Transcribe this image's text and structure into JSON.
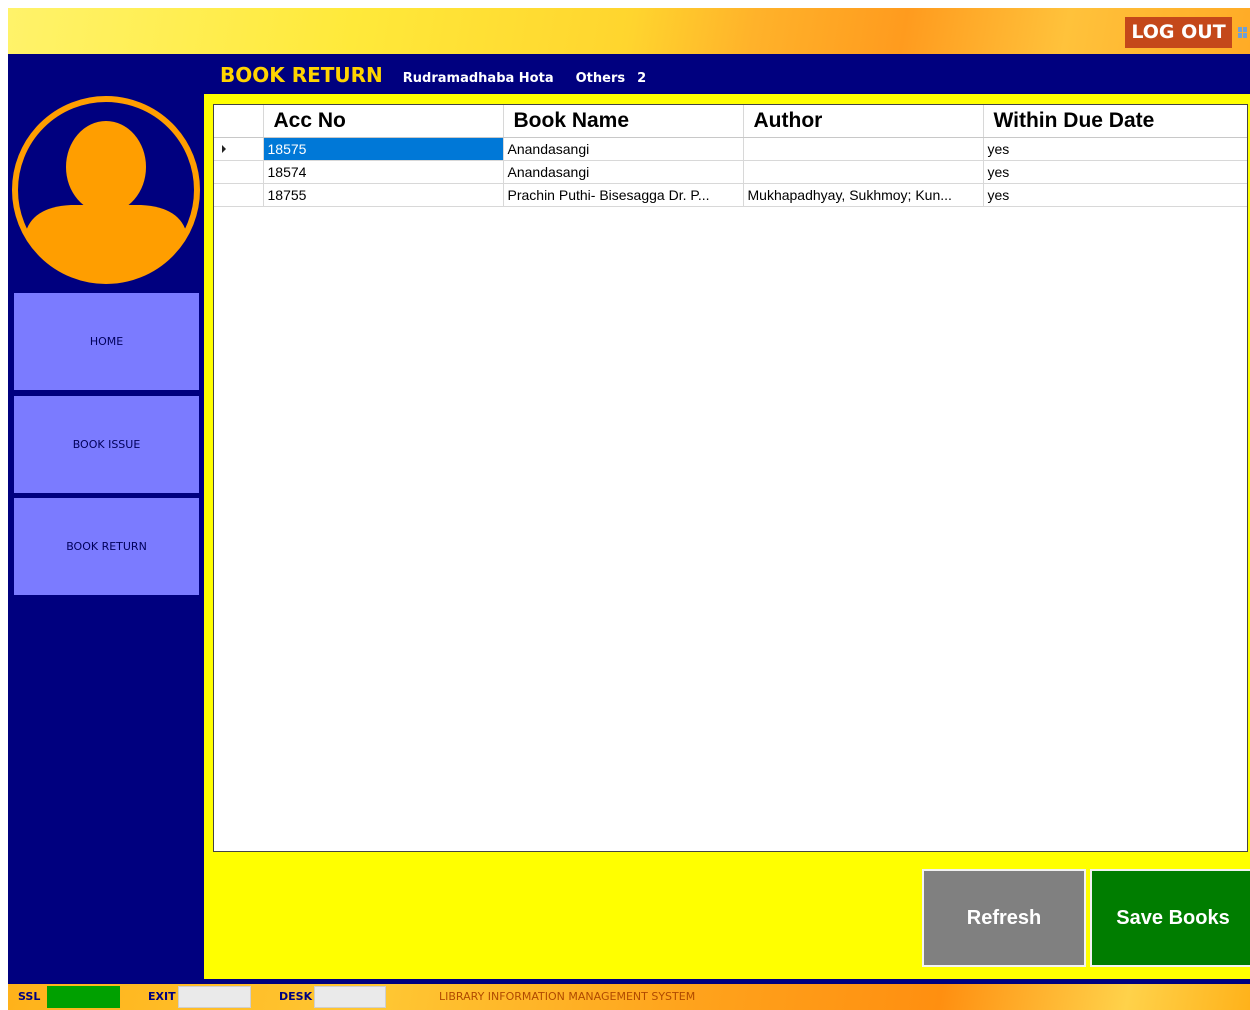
{
  "topbar": {
    "logout_label": "LOG OUT"
  },
  "header": {
    "title": "BOOK RETURN",
    "user_name": "Rudramadhaba Hota",
    "category": "Others",
    "count": "2"
  },
  "sidebar": {
    "items": [
      {
        "label": "HOME"
      },
      {
        "label": "BOOK ISSUE"
      },
      {
        "label": "BOOK RETURN"
      }
    ]
  },
  "grid": {
    "columns": [
      "Acc No",
      "Book Name",
      "Author",
      "Within Due Date"
    ],
    "rows": [
      {
        "acc_no": "18575",
        "book_name": "Anandasangi",
        "author": "",
        "within_due": "yes",
        "selected": true
      },
      {
        "acc_no": "18574",
        "book_name": "Anandasangi",
        "author": "",
        "within_due": "yes"
      },
      {
        "acc_no": "18755",
        "book_name": "Prachin Puthi- Bisesagga Dr. P...",
        "author": "Mukhapadhyay, Sukhmoy; Kun...",
        "within_due": "yes"
      }
    ]
  },
  "buttons": {
    "refresh_label": "Refresh",
    "save_label": "Save Books"
  },
  "statusbar": {
    "ssl_label": "SSL",
    "ssl_color": "#00a000",
    "exit_label": "EXIT",
    "desk_label": "DESK",
    "footer_text": "LIBRARY INFORMATION MANAGEMENT SYSTEM"
  },
  "colors": {
    "background": "#00007f",
    "accent_yellow": "#ffff00",
    "title_yellow": "#ffd400",
    "nav_button": "#7b7bff",
    "avatar": "#ff9e00",
    "logout": "#c4481a",
    "selected_cell": "#0078d7",
    "refresh": "#808080",
    "save": "#007d00"
  },
  "icons": {
    "avatar": "user-avatar-icon",
    "window": "window-icon",
    "row_pointer": "row-pointer-icon"
  }
}
